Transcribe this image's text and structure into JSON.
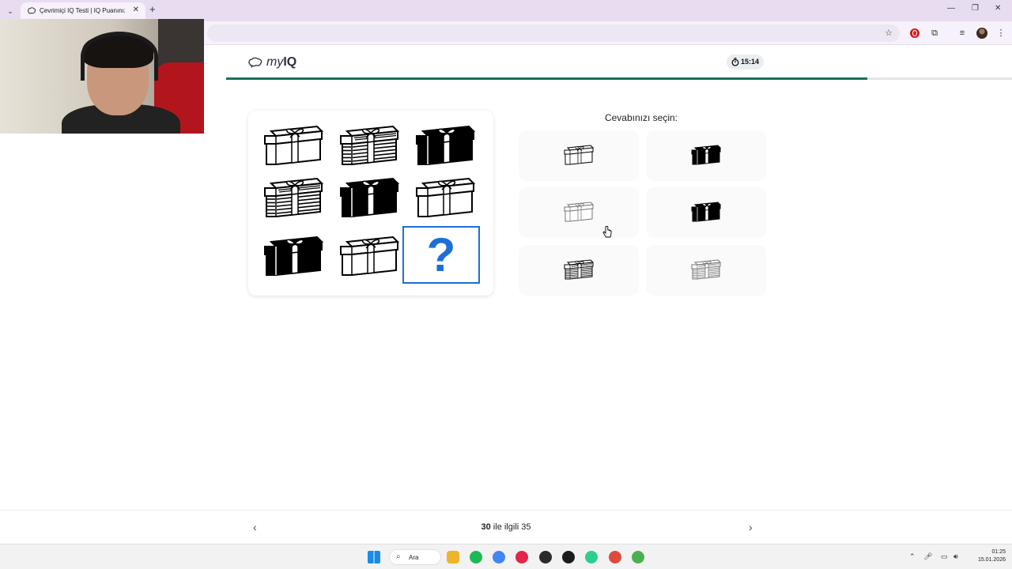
{
  "browser": {
    "tab_title": "Çevrimiçi IQ Testi | IQ Puanınızı",
    "close_glyph": "✕",
    "new_tab_glyph": "+",
    "menu_glyph": "⌄",
    "win_min": "—",
    "win_max": "❐",
    "win_close": "✕",
    "star_glyph": "☆",
    "ext_glyph": "⧉",
    "media_glyph": "≡",
    "kebab_glyph": "⋮"
  },
  "header": {
    "logo_my": "my",
    "logo_iq": "IQ",
    "timer": "15:14",
    "progress": 0.816
  },
  "puzzle": {
    "cells": [
      {
        "style": "outline"
      },
      {
        "style": "striped"
      },
      {
        "style": "solid"
      },
      {
        "style": "striped"
      },
      {
        "style": "solid"
      },
      {
        "style": "outline"
      },
      {
        "style": "solid"
      },
      {
        "style": "outline"
      },
      {
        "style": "question"
      }
    ],
    "question_mark": "?"
  },
  "answers": {
    "title": "Cevabınızı seçin:",
    "options": [
      {
        "style": "outline"
      },
      {
        "style": "solid"
      },
      {
        "style": "outline-light"
      },
      {
        "style": "solid"
      },
      {
        "style": "striped"
      },
      {
        "style": "striped-light"
      }
    ]
  },
  "footer": {
    "current": "30",
    "counter_rest": " ile ilgili 35",
    "prev_glyph": "‹",
    "next_glyph": "›"
  },
  "taskbar": {
    "search_label": "Ara",
    "search_glyph": "⌕",
    "tray_up": "⌃",
    "tray_mic": "🎤︎",
    "tray_volume": "🔊︎",
    "tray_display": "▭",
    "time": "01:25",
    "date": "15.01.2026",
    "apps": [
      {
        "name": "windows-start",
        "color": "#1a8ce8"
      },
      {
        "name": "file-explorer",
        "color": "#f0b429"
      },
      {
        "name": "spotify",
        "color": "#1db954"
      },
      {
        "name": "chrome",
        "color": "#4285f4"
      },
      {
        "name": "app-bolt",
        "color": "#e2254a"
      },
      {
        "name": "app-dark-1",
        "color": "#2b2b2b"
      },
      {
        "name": "app-dark-2",
        "color": "#1c1c1c"
      },
      {
        "name": "app-green",
        "color": "#2ccf8d"
      },
      {
        "name": "chrome-2",
        "color": "#dd4b3e"
      },
      {
        "name": "chrome-3",
        "color": "#4caf50"
      }
    ]
  }
}
